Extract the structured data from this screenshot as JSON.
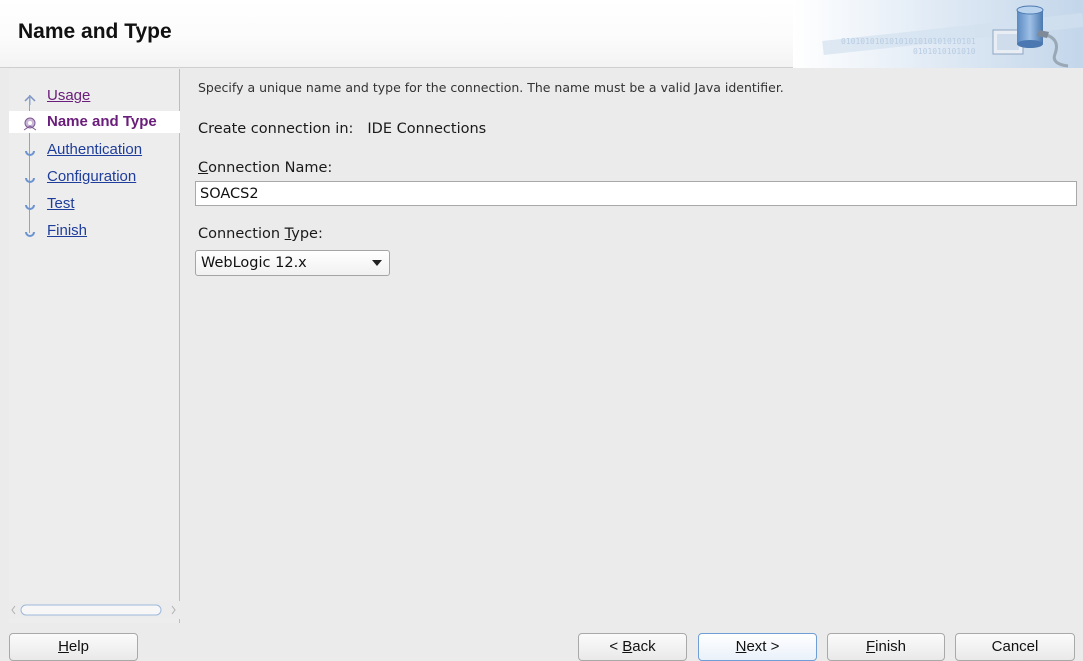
{
  "header": {
    "title": "Name and Type",
    "graphic_text_line1": "0101010101010101010101010101",
    "graphic_text_line2": "0101010101010"
  },
  "nav": {
    "items": [
      {
        "label": "Usage",
        "state": "visited",
        "icon": "step-visited-icon"
      },
      {
        "label": "Name and Type",
        "state": "current",
        "icon": "step-current-icon"
      },
      {
        "label": "Authentication",
        "state": "pending",
        "icon": "step-pending-icon"
      },
      {
        "label": "Configuration",
        "state": "pending",
        "icon": "step-pending-icon"
      },
      {
        "label": "Test",
        "state": "pending",
        "icon": "step-pending-icon"
      },
      {
        "label": "Finish",
        "state": "pending",
        "icon": "step-pending-icon"
      }
    ]
  },
  "main": {
    "description": "Specify a unique name and type for the connection. The name must be a valid Java identifier.",
    "create_in_label": "Create connection in:",
    "create_in_value": "IDE Connections",
    "connection_name_label_mnemonic": "C",
    "connection_name_label_rest": "onnection Name:",
    "connection_name_value": "SOACS2",
    "connection_type_label_pre": "Connection ",
    "connection_type_label_mnemonic": "T",
    "connection_type_label_post": "ype:",
    "connection_type_value": "WebLogic 12.x"
  },
  "buttons": {
    "help_mnemonic": "H",
    "help_rest": "elp",
    "back_pre": "< ",
    "back_mnemonic": "B",
    "back_rest": "ack",
    "next_mnemonic": "N",
    "next_rest": "ext >",
    "finish_mnemonic": "F",
    "finish_rest": "inish",
    "cancel": "Cancel"
  },
  "colors": {
    "link": "#1f3d9b",
    "visited": "#6a1d7a",
    "default_button_border": "#6f9ed6"
  }
}
